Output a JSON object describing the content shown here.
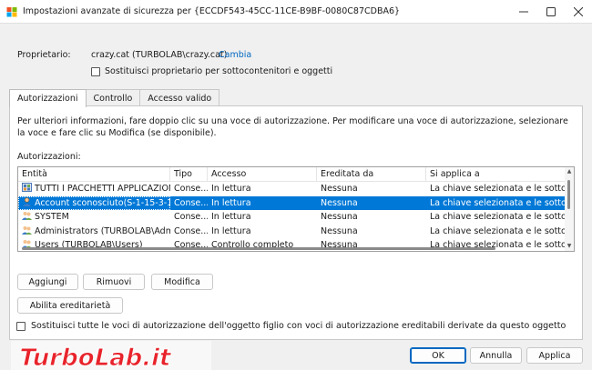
{
  "window": {
    "title": "Impostazioni avanzate di sicurezza per {ECCDF543-45CC-11CE-B9BF-0080C87CDBA6}",
    "minimize_icon": "minimize-icon",
    "maximize_icon": "maximize-icon",
    "close_icon": "close-icon"
  },
  "owner": {
    "label": "Proprietario:",
    "value": "crazy.cat (TURBOLAB\\crazy.cat)",
    "change_link": "Cambia",
    "replace_owner_checkbox": "Sostituisci proprietario per sottocontenitori e oggetti",
    "replace_owner_checked": false
  },
  "tabs": [
    {
      "label": "Autorizzazioni",
      "active": true
    },
    {
      "label": "Controllo",
      "active": false
    },
    {
      "label": "Accesso valido",
      "active": false
    }
  ],
  "permissions": {
    "info_text": "Per ulteriori informazioni, fare doppio clic su una voce di autorizzazione. Per modificare una voce di autorizzazione, selezionare la voce e fare clic su Modifica (se disponibile).",
    "list_label": "Autorizzazioni:",
    "columns": [
      "Entità",
      "Tipo",
      "Accesso",
      "Ereditata da",
      "Si applica a"
    ],
    "rows": [
      {
        "icon": "package-icon",
        "entity": "TUTTI I PACCHETTI APPLICAZIONI",
        "type": "Conse...",
        "access": "In lettura",
        "inherited": "Nessuna",
        "applies": "La chiave selezionata e le sottoc...",
        "selected": false
      },
      {
        "icon": "user-icon",
        "entity": "Account sconosciuto(S-1-15-3-10...",
        "type": "Conse...",
        "access": "In lettura",
        "inherited": "Nessuna",
        "applies": "La chiave selezionata e le sottoc...",
        "selected": true
      },
      {
        "icon": "group-icon",
        "entity": "SYSTEM",
        "type": "Conse...",
        "access": "In lettura",
        "inherited": "Nessuna",
        "applies": "La chiave selezionata e le sottoc...",
        "selected": false
      },
      {
        "icon": "group-icon",
        "entity": "Administrators (TURBOLAB\\Admi...",
        "type": "Conse...",
        "access": "In lettura",
        "inherited": "Nessuna",
        "applies": "La chiave selezionata e le sottoc...",
        "selected": false
      },
      {
        "icon": "group-icon",
        "entity": "Users (TURBOLAB\\Users)",
        "type": "Conse...",
        "access": "Controllo completo",
        "inherited": "Nessuna",
        "applies": "La chiave selezionata e le sottoc...",
        "selected": false
      }
    ],
    "add_button": "Aggiungi",
    "remove_button": "Rimuovi",
    "edit_button": "Modifica",
    "enable_inheritance_button": "Abilita ereditarietà"
  },
  "replace_child": {
    "text": "Sostituisci tutte le voci di autorizzazione dell'oggetto figlio con voci di autorizzazione ereditabili derivate da questo oggetto",
    "checked": false
  },
  "footer": {
    "ok_button": "OK",
    "cancel_button": "Annulla",
    "apply_button": "Applica"
  },
  "watermark": {
    "text": "TurboLab.it"
  },
  "colors": {
    "selection": "#0078d7",
    "link": "#0067c0",
    "watermark_red": "#e8232b"
  }
}
